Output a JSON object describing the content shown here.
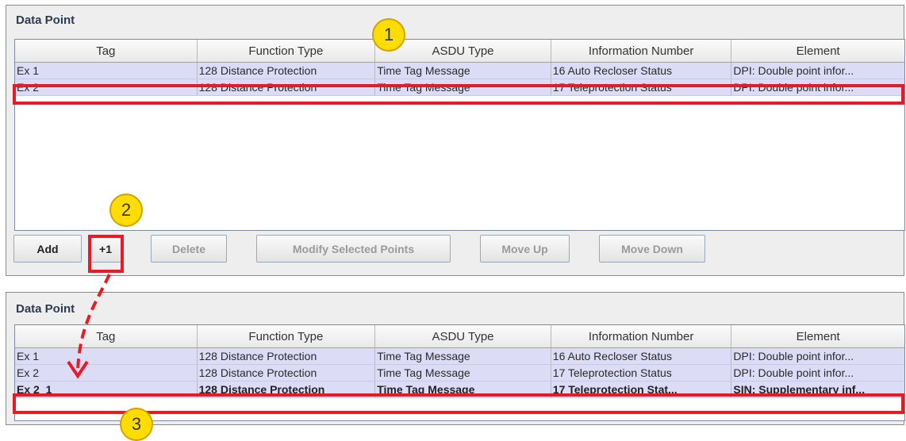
{
  "columns": [
    "Tag",
    "Function Type",
    "ASDU Type",
    "Information Number",
    "Element"
  ],
  "panel1": {
    "title": "Data Point",
    "rows": [
      {
        "tag": "Ex 1",
        "function_type": "128 Distance Protection",
        "asdu_type": "Time Tag Message",
        "info_number": "16  Auto Recloser Status",
        "element": "DPI: Double point infor..."
      },
      {
        "tag": "Ex 2",
        "function_type": "128 Distance Protection",
        "asdu_type": "Time Tag Message",
        "info_number": "17  Teleprotection Status",
        "element": "DPI: Double point infor..."
      }
    ],
    "buttons": {
      "add": "Add",
      "plus1": "+1",
      "delete": "Delete",
      "modify": "Modify Selected Points",
      "move_up": "Move Up",
      "move_down": "Move Down"
    }
  },
  "panel2": {
    "title": "Data Point",
    "rows": [
      {
        "tag": "Ex 1",
        "function_type": "128 Distance Protection",
        "asdu_type": "Time Tag Message",
        "info_number": "16  Auto Recloser Status",
        "element": "DPI: Double point infor..."
      },
      {
        "tag": "Ex 2",
        "function_type": "128 Distance Protection",
        "asdu_type": "Time Tag Message",
        "info_number": "17  Teleprotection Status",
        "element": "DPI: Double point infor..."
      },
      {
        "tag": "Ex 2_1",
        "function_type": "128 Distance Protection",
        "asdu_type": "Time Tag Message",
        "info_number": "17  Teleprotection Stat...",
        "element": "SIN: Supplementary inf..."
      }
    ]
  },
  "callouts": [
    "1",
    "2",
    "3"
  ],
  "colors": {
    "annotation_red": "#e81b24",
    "callout_yellow": "#ffdd00",
    "row_bg": "#dcdcf6"
  }
}
